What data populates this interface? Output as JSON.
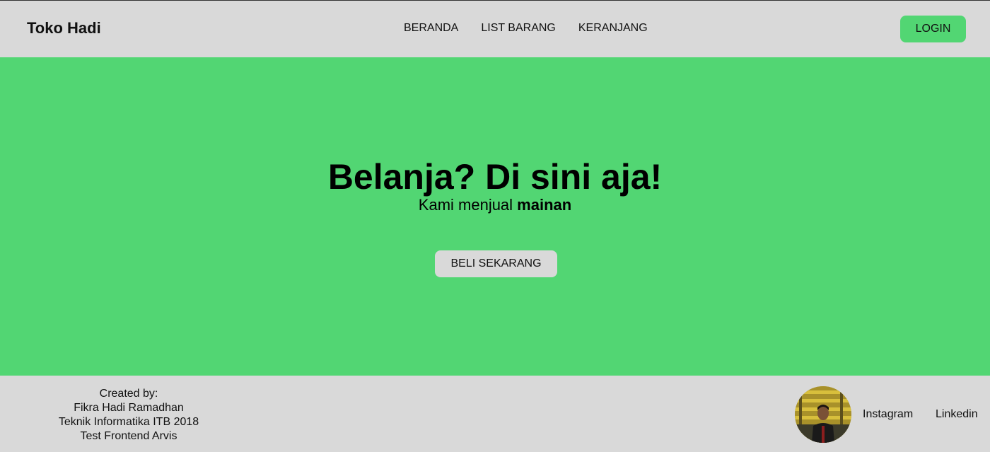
{
  "header": {
    "brand": "Toko Hadi",
    "nav": [
      "BERANDA",
      "LIST BARANG",
      "KERANJANG"
    ],
    "login_label": "LOGIN"
  },
  "hero": {
    "title": "Belanja? Di sini aja!",
    "subtitle_prefix": "Kami menjual ",
    "subtitle_bold": "mainan",
    "cta_label": "BELI SEKARANG"
  },
  "footer": {
    "credits": [
      "Created by:",
      "Fikra Hadi Ramadhan",
      "Teknik Informatika ITB 2018",
      "Test Frontend Arvis"
    ],
    "links": {
      "instagram": "Instagram",
      "linkedin": "Linkedin"
    }
  },
  "colors": {
    "accent_green": "#52d673",
    "surface_gray": "#d9d9d9"
  }
}
